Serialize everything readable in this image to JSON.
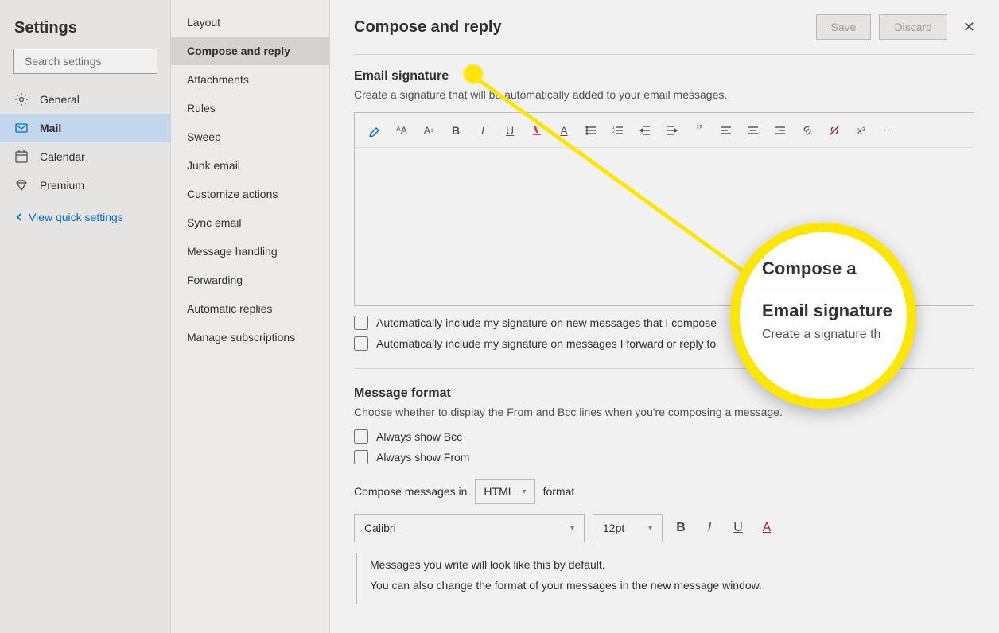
{
  "left": {
    "title": "Settings",
    "search_placeholder": "Search settings",
    "nav": [
      {
        "icon": "gear-icon",
        "label": "General"
      },
      {
        "icon": "mail-icon",
        "label": "Mail",
        "selected": true
      },
      {
        "icon": "calendar-icon",
        "label": "Calendar"
      },
      {
        "icon": "diamond-icon",
        "label": "Premium"
      }
    ],
    "quick_label": "View quick settings"
  },
  "mid": {
    "items": [
      "Layout",
      "Compose and reply",
      "Attachments",
      "Rules",
      "Sweep",
      "Junk email",
      "Customize actions",
      "Sync email",
      "Message handling",
      "Forwarding",
      "Automatic replies",
      "Manage subscriptions"
    ],
    "selected_index": 1
  },
  "main": {
    "title": "Compose and reply",
    "save_label": "Save",
    "discard_label": "Discard",
    "sig": {
      "title": "Email signature",
      "sub": "Create a signature that will be automatically added to your email messages.",
      "check_new": "Automatically include my signature on new messages that I compose",
      "check_reply": "Automatically include my signature on messages I forward or reply to"
    },
    "fmt": {
      "title": "Message format",
      "sub": "Choose whether to display the From and Bcc lines when you're composing a message.",
      "check_bcc": "Always show Bcc",
      "check_from": "Always show From",
      "compose_prefix": "Compose messages in",
      "compose_value": "HTML",
      "compose_suffix": "format",
      "font": "Calibri",
      "size": "12pt",
      "preview1": "Messages you write will look like this by default.",
      "preview2": "You can also change the format of your messages in the new message window."
    }
  },
  "callout": {
    "line1": "Compose a",
    "line2": "Email signature",
    "line3": "Create a signature th"
  }
}
